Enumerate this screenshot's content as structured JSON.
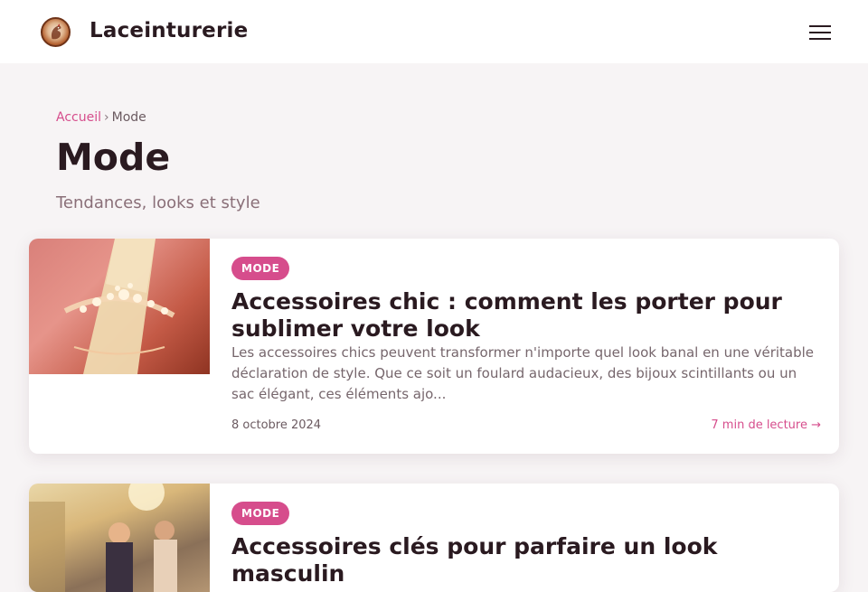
{
  "header": {
    "site_title": "Laceinturerie",
    "logo_icon": "rooster-logo-icon",
    "menu_icon": "hamburger-menu-icon"
  },
  "breadcrumb": {
    "home": "Accueil",
    "separator": "›",
    "current": "Mode"
  },
  "page": {
    "title": "Mode",
    "subtitle": "Tendances, looks et style"
  },
  "articles": [
    {
      "category": "MODE",
      "title": "Accessoires chic : comment les porter pour sublimer votre look",
      "excerpt": "Les accessoires chics peuvent transformer n'importe quel look banal en une véritable déclaration de style. Que ce soit un foulard audacieux, des bijoux scintillants ou un sac élégant, ces éléments ajo...",
      "date": "8 octobre 2024",
      "read_time": "7 min de lecture →"
    },
    {
      "category": "MODE",
      "title": "Accessoires clés pour parfaire un look masculin"
    }
  ],
  "colors": {
    "accent": "#d64d8c",
    "background": "#f7f4f5",
    "text": "#2a1a20"
  }
}
